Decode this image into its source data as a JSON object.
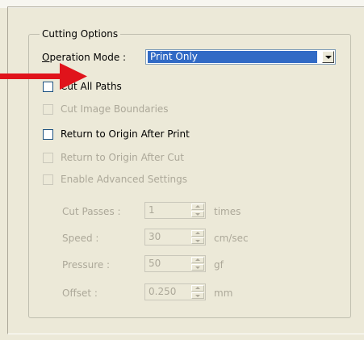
{
  "group": {
    "title": "Cutting Options"
  },
  "operation_mode": {
    "label_prefix": "O",
    "label_rest": "peration Mode :",
    "selected": "Print Only"
  },
  "checkboxes": [
    {
      "label": "Cut All Paths",
      "checked": false,
      "enabled": true
    },
    {
      "label": "Cut Image Boundaries",
      "checked": false,
      "enabled": false
    },
    {
      "label": "Return to Origin After Print",
      "checked": false,
      "enabled": true
    },
    {
      "label": "Return to Origin After Cut",
      "checked": false,
      "enabled": false
    },
    {
      "label": "Enable Advanced Settings",
      "checked": false,
      "enabled": false
    }
  ],
  "fields": [
    {
      "label": "Cut Passes :",
      "value": "1",
      "unit": "times"
    },
    {
      "label": "Speed :",
      "value": "30",
      "unit": "cm/sec"
    },
    {
      "label": "Pressure :",
      "value": "50",
      "unit": "gf"
    },
    {
      "label": "Offset :",
      "value": "0.250",
      "unit": "mm"
    }
  ],
  "colors": {
    "background": "#ece9d8",
    "selection": "#316ac5",
    "arrow": "#e0131b",
    "disabled_text": "#aca899"
  }
}
